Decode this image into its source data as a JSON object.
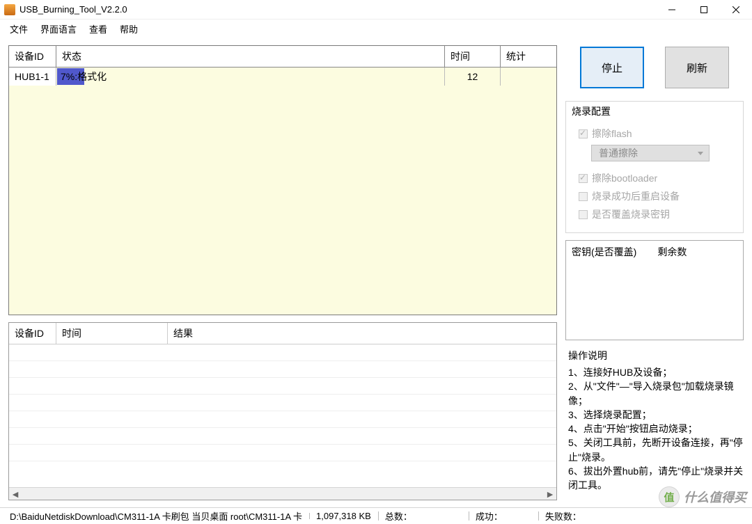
{
  "window": {
    "title": "USB_Burning_Tool_V2.2.0"
  },
  "menu": {
    "file": "文件",
    "lang": "界面语言",
    "view": "查看",
    "help": "帮助"
  },
  "table1": {
    "headers": {
      "id": "设备ID",
      "status": "状态",
      "time": "时间",
      "stat": "统计"
    },
    "row": {
      "id": "HUB1-1",
      "status_text": "7%:格式化",
      "progress_pct": 7,
      "time": "12",
      "stat": ""
    }
  },
  "table2": {
    "headers": {
      "id": "设备ID",
      "time": "时间",
      "result": "结果"
    }
  },
  "buttons": {
    "stop": "停止",
    "refresh": "刷新"
  },
  "config": {
    "title": "烧录配置",
    "erase_flash": "擦除flash",
    "erase_mode": "普通擦除",
    "erase_bootloader": "擦除bootloader",
    "reboot_after": "烧录成功后重启设备",
    "overwrite_key": "是否覆盖烧录密钥"
  },
  "keybox": {
    "col1": "密钥(是否覆盖)",
    "col2": "剩余数"
  },
  "help": {
    "title": "操作说明",
    "l1": "1、连接好HUB及设备；",
    "l2": "2、从\"文件\"—\"导入烧录包\"加载烧录镜像；",
    "l3": "3、选择烧录配置；",
    "l4": "4、点击\"开始\"按钮启动烧录；",
    "l5": "5、关闭工具前，先断开设备连接，再\"停止\"烧录。",
    "l6": "6、拔出外置hub前，请先\"停止\"烧录并关闭工具。"
  },
  "status": {
    "path": "D:\\BaiduNetdiskDownload\\CM311-1A 卡刷包 当贝桌面 root\\CM311-1A 卡",
    "size": "1,097,318 KB",
    "total": "总数：",
    "success": "成功：",
    "fail": "失败数："
  },
  "watermark": {
    "badge": "值",
    "text": "什么值得买"
  }
}
